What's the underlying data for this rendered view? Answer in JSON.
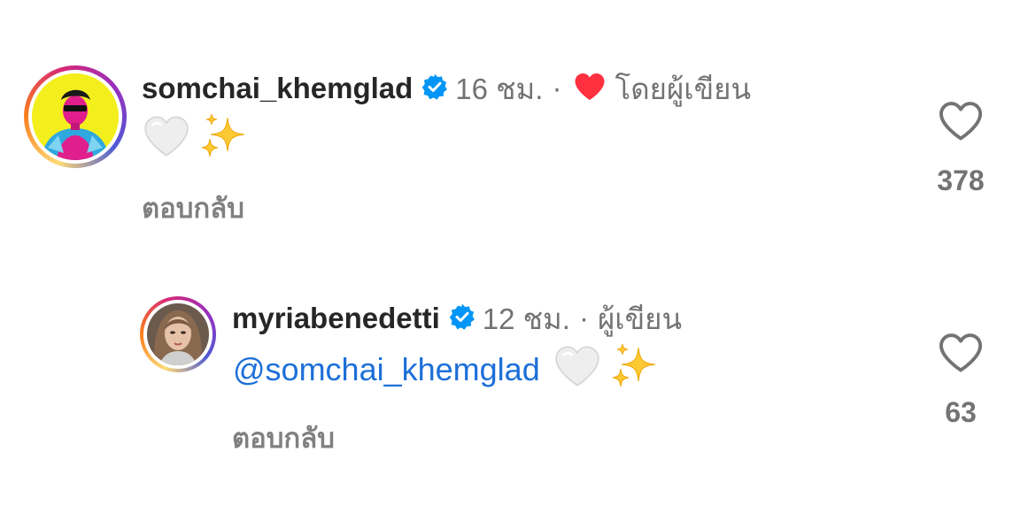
{
  "comments": [
    {
      "username": "somchai_khemglad",
      "time": "16 ชม.",
      "separator": "·",
      "author_liked_label": "โดยผู้เขียน",
      "reply_label": "ตอบกลับ",
      "like_count": "378",
      "colors": {
        "avatar_bg": "#f3ef1c",
        "heart": "#ff3040"
      }
    },
    {
      "username": "myriabenedetti",
      "time": "12 ชม.",
      "separator": "·",
      "author_label": "ผู้เขียน",
      "mention": "@somchai_khemglad",
      "reply_label": "ตอบกลับ",
      "like_count": "63"
    }
  ],
  "icons": {
    "verified": "verified-badge-icon",
    "like": "heart-outline-icon",
    "white_heart": "white-heart-emoji-icon",
    "sparkles": "sparkles-emoji-icon"
  },
  "accent_colors": {
    "verified_blue": "#0095f6",
    "mention_blue": "#1d6fd8",
    "muted_text": "#737373"
  }
}
